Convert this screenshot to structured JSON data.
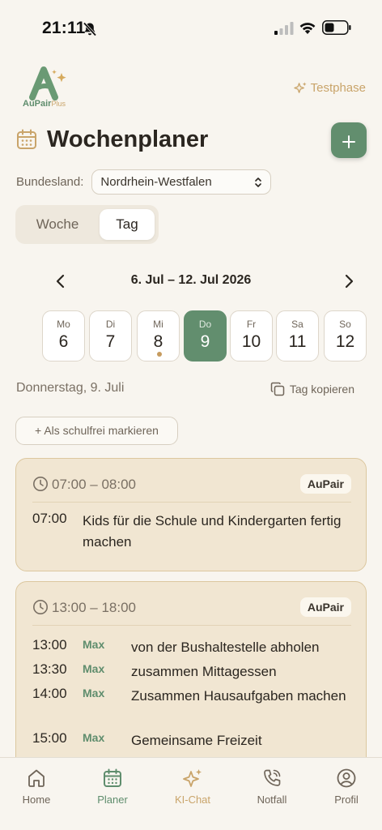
{
  "status_bar": {
    "time": "21:11"
  },
  "app": {
    "logo_name": "AuPair",
    "logo_suffix": "Plus",
    "trial_label": "Testphase"
  },
  "page": {
    "title": "Wochenplaner"
  },
  "filters": {
    "state_label": "Bundesland:",
    "state_value": "Nordrhein-Westfalen"
  },
  "view_toggle": {
    "week_label": "Woche",
    "day_label": "Tag",
    "selected": "Tag"
  },
  "week": {
    "range": "6. Jul – 12. Jul 2026",
    "days": [
      {
        "name": "Mo",
        "num": "6",
        "active": false,
        "dot": false
      },
      {
        "name": "Di",
        "num": "7",
        "active": false,
        "dot": false
      },
      {
        "name": "Mi",
        "num": "8",
        "active": false,
        "dot": true
      },
      {
        "name": "Do",
        "num": "9",
        "active": true,
        "dot": false
      },
      {
        "name": "Fr",
        "num": "10",
        "active": false,
        "dot": false
      },
      {
        "name": "Sa",
        "num": "11",
        "active": false,
        "dot": false
      },
      {
        "name": "So",
        "num": "12",
        "active": false,
        "dot": false
      }
    ]
  },
  "day": {
    "selected_date": "Donnerstag, 9. Juli",
    "copy_label": "Tag kopieren",
    "schoolfree_label": "+ Als schulfrei markieren"
  },
  "blocks": [
    {
      "time_range": "07:00 – 08:00",
      "badge": "AuPair",
      "entries": [
        {
          "time": "07:00",
          "person": "",
          "text": "Kids für die Schule und Kindergarten fertig machen"
        }
      ]
    },
    {
      "time_range": "13:00 – 18:00",
      "badge": "AuPair",
      "entries": [
        {
          "time": "13:00",
          "person": "Max",
          "text": "von der Bushaltestelle abholen"
        },
        {
          "time": "13:30",
          "person": "Max",
          "text": "zusammen Mittagessen"
        },
        {
          "time": "14:00",
          "person": "Max",
          "text": "Zusammen Hausaufgaben machen"
        },
        {
          "time": "15:00",
          "person": "Max",
          "text": "Gemeinsame Freizeit"
        }
      ]
    }
  ],
  "tabbar": {
    "items": [
      {
        "label": "Home"
      },
      {
        "label": "Planer"
      },
      {
        "label": "KI-Chat"
      },
      {
        "label": "Notfall"
      },
      {
        "label": "Profil"
      }
    ]
  },
  "colors": {
    "accent": "#628e6e",
    "gold": "#c9a46a",
    "card_bg": "#f1e6d2",
    "background": "#f8f5ef"
  }
}
